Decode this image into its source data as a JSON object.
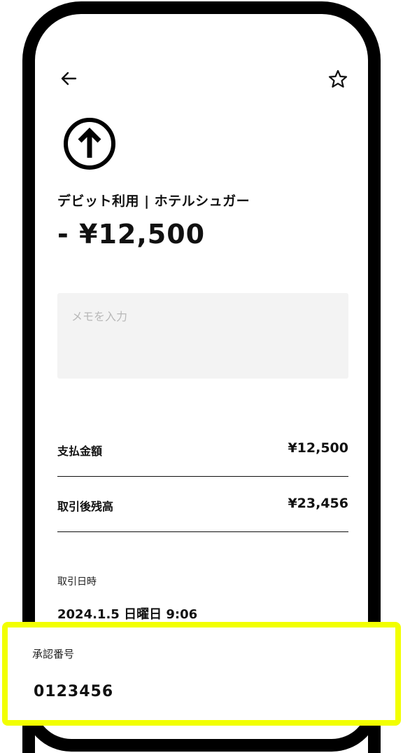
{
  "header": {
    "back_icon": "arrow-left-icon",
    "favorite_icon": "star-outline-icon"
  },
  "transaction": {
    "icon": "arrow-up-circle-icon",
    "title": "デビット利用 | ホテルシュガー",
    "amount": "- ¥12,500"
  },
  "memo": {
    "placeholder": "メモを入力"
  },
  "details": {
    "payment_label": "支払金額",
    "payment_value": "¥12,500",
    "balance_label": "取引後残高",
    "balance_value": "¥23,456",
    "datetime_label": "取引日時",
    "datetime_value": "2024.1.5 日曜日 9:06",
    "approval_label": "承認番号",
    "approval_value": "0123456"
  },
  "colors": {
    "highlight": "#f2ff00",
    "frame": "#000000",
    "memo_bg": "#f3f3f3"
  }
}
